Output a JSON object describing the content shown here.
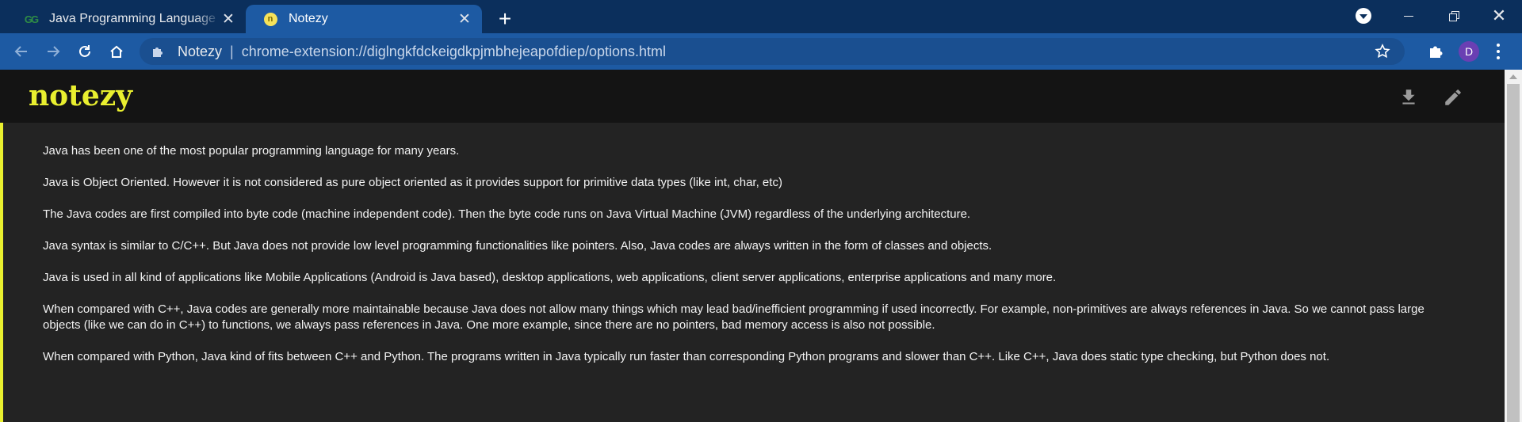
{
  "browser": {
    "tabs": [
      {
        "title": "Java Programming Language - GeeksforGeeks",
        "favicon": "geeksforgeeks-icon",
        "active": false
      },
      {
        "title": "Notezy",
        "favicon": "notezy-icon",
        "active": true
      }
    ],
    "new_tab": "+",
    "omnibox": {
      "site_name": "Notezy",
      "separator": "|",
      "url": "chrome-extension://diglngkfdckeigdkpjmbhejeapofdiep/options.html"
    },
    "profile_initial": "D"
  },
  "app": {
    "logo": "notezy",
    "accent_color": "#e9ef2f",
    "icons": [
      "download-icon",
      "edit-icon"
    ]
  },
  "note": {
    "paragraphs": [
      "Java has been one of the most popular programming language for many years.",
      "Java is Object Oriented. However it is not considered as pure object oriented as it provides support for primitive data types (like int, char, etc)",
      "The Java codes are first compiled into byte code (machine independent code). Then the byte code runs on Java Virtual Machine (JVM) regardless of the underlying architecture.",
      "Java syntax is similar to C/C++. But Java does not provide low level programming functionalities like pointers. Also, Java codes are always written in the form of classes and objects.",
      "Java is used in all kind of applications like Mobile Applications (Android is Java based), desktop applications, web applications, client server applications, enterprise applications and many more.",
      "When compared with C++, Java codes are generally more maintainable because Java does not allow many things which may lead bad/inefficient programming if used incorrectly. For example, non-primitives are always references in Java. So we cannot pass large objects (like we can do in C++) to functions, we always pass references in Java. One more example, since there are no pointers, bad memory access is also not possible.",
      "When compared with Python, Java kind of fits between C++ and Python. The programs written in Java typically run faster than corresponding Python programs and slower than C++. Like C++, Java does static type checking, but Python does not."
    ]
  }
}
